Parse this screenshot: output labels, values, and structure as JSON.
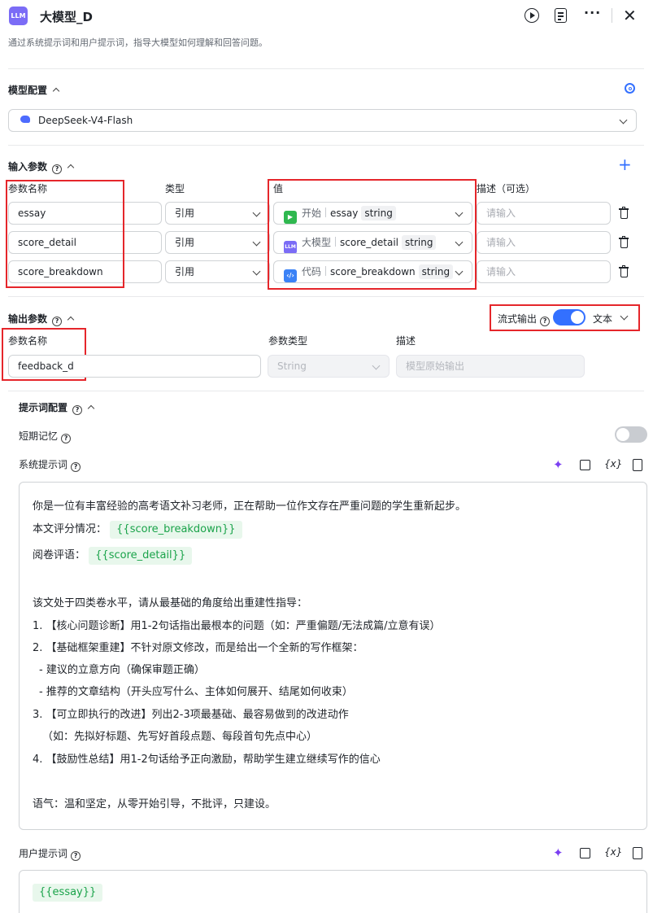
{
  "header": {
    "badge": "LLM",
    "title": "大模型_D",
    "description": "通过系统提示词和用户提示词，指导大模型如何理解和回答问题。"
  },
  "model_config": {
    "title": "模型配置",
    "selected_model": "DeepSeek-V4-Flash"
  },
  "input_params": {
    "title": "输入参数",
    "col_name": "参数名称",
    "col_type": "类型",
    "col_value": "值",
    "col_desc": "描述（可选）",
    "rows": [
      {
        "name": "essay",
        "type": "引用",
        "source": "开始",
        "var": "essay",
        "vtype": "string",
        "desc_placeholder": "请输入"
      },
      {
        "name": "score_detail",
        "type": "引用",
        "source": "大模型",
        "var": "score_detail",
        "vtype": "string",
        "desc_placeholder": "请输入"
      },
      {
        "name": "score_breakdown",
        "type": "引用",
        "source": "代码",
        "var": "score_breakdown",
        "vtype": "string",
        "desc_placeholder": "请输入"
      }
    ]
  },
  "output_params": {
    "title": "输出参数",
    "streaming_label": "流式输出",
    "format": "文本",
    "col_name": "参数名称",
    "col_type": "参数类型",
    "col_desc": "描述",
    "name": "feedback_d",
    "type": "String",
    "desc_placeholder": "模型原始输出"
  },
  "prompt_config": {
    "title": "提示词配置",
    "short_memory": "短期记忆",
    "system_prompt_label": "系统提示词",
    "user_prompt_label": "用户提示词",
    "var_tool": "{x}",
    "system_lines": [
      "你是一位有丰富经验的高考语文补习老师，正在帮助一位作文存在严重问题的学生重新起步。",
      "该文处于四类卷水平，请从最基础的角度给出重建性指导：",
      "1. 【核心问题诊断】用1-2句话指出最根本的问题（如：严重偏题/无法成篇/立意有误）",
      "2. 【基础框架重建】不针对原文修改，而是给出一个全新的写作框架：",
      "- 建议的立意方向（确保审题正确）",
      "- 推荐的文章结构（开头应写什么、主体如何展开、结尾如何收束）",
      "3. 【可立即执行的改进】列出2-3项最基础、最容易做到的改进动作",
      "（如：先拟好标题、先写好首段点题、每段首句先点中心）",
      "4. 【鼓励性总结】用1-2句话给予正向激励，帮助学生建立继续写作的信心",
      "语气：温和坚定，从零开始引导，不批评，只建设。"
    ],
    "score_label": "本文评分情况：",
    "score_var": "{{score_breakdown}}",
    "review_label": "阅卷评语：",
    "review_var": "{{score_detail}}",
    "user_var": "{{essay}}"
  },
  "colors": {
    "accent": "#3370ff",
    "badge": "#7b6cf6",
    "highlight_red": "#e5262b",
    "var_green": "#1aa34a"
  }
}
